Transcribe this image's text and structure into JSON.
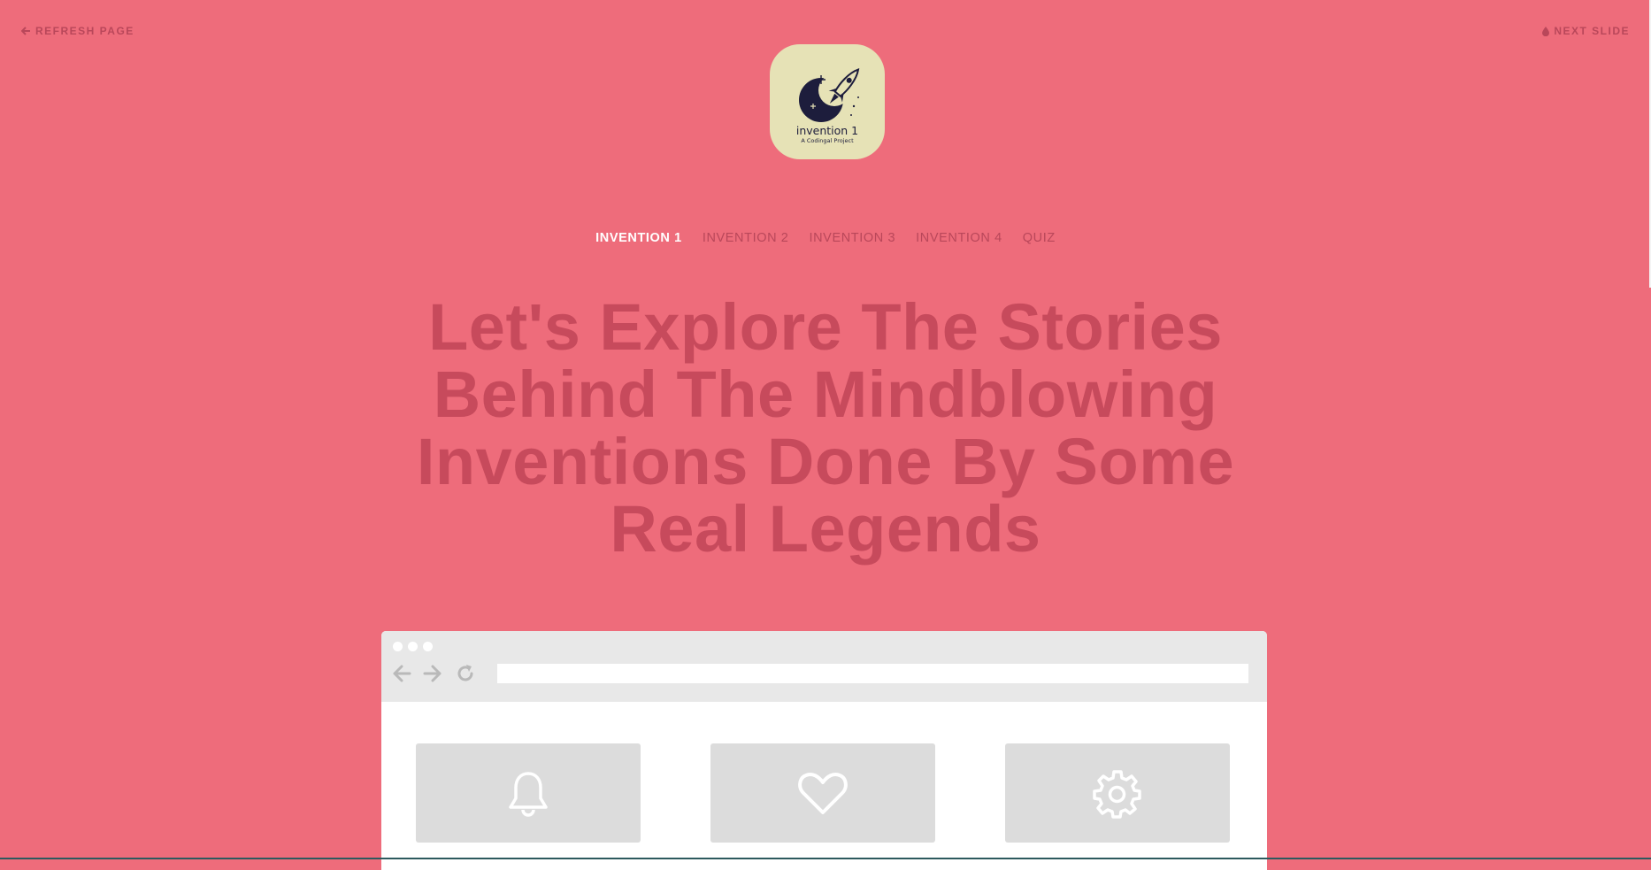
{
  "top_left_link": {
    "label": "REFRESH PAGE",
    "icon": "arrow-left-icon"
  },
  "top_right_link": {
    "label": "NEXT SLIDE",
    "icon": "drop-icon"
  },
  "logo": {
    "title": "invention 1",
    "subtitle": "A Codingal Project",
    "background_color": "#e6e2b6",
    "mark_color": "#1d1d3c"
  },
  "nav": {
    "items": [
      {
        "label": "INVENTION 1",
        "active": true
      },
      {
        "label": "INVENTION 2",
        "active": false
      },
      {
        "label": "INVENTION 3",
        "active": false
      },
      {
        "label": "INVENTION 4",
        "active": false
      },
      {
        "label": "QUIZ",
        "active": false
      }
    ]
  },
  "headline": "Let's Explore The Stories Behind The Mindblowing Inventions Done By Some Real Legends",
  "browser_mock": {
    "url_value": "",
    "controls": [
      "back-arrow-icon",
      "forward-arrow-icon",
      "reload-icon"
    ],
    "cards": [
      {
        "icon": "bell-icon"
      },
      {
        "icon": "heart-icon"
      },
      {
        "icon": "gear-icon"
      }
    ]
  },
  "colors": {
    "page_background": "#ee6c7b",
    "headline": "#c74a5c",
    "nav_inactive": "#b9475a",
    "nav_active": "#ffffff",
    "card_background": "#dcdcdc",
    "browser_bar": "#e8e8e8"
  }
}
